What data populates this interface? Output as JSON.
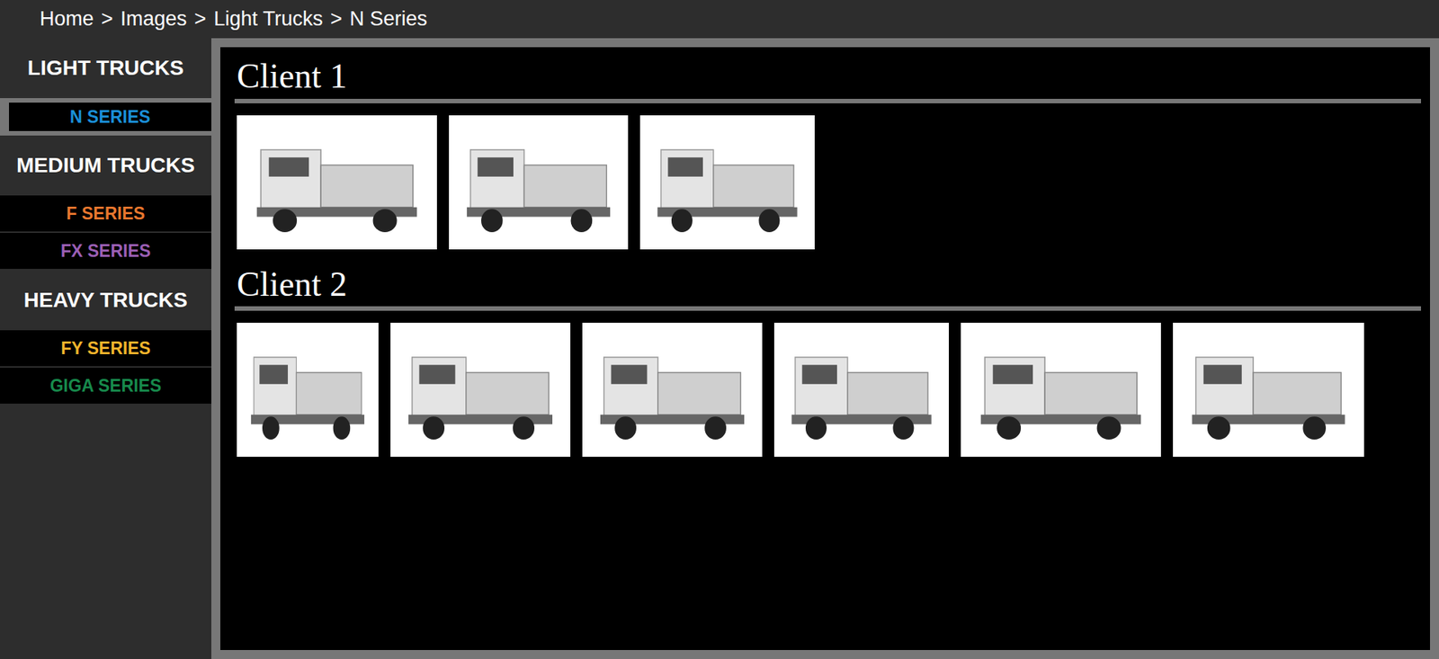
{
  "breadcrumb": {
    "items": [
      "Home",
      "Images",
      "Light Trucks",
      "N Series"
    ],
    "separator": ">"
  },
  "sidebar": {
    "items": [
      {
        "label": "LIGHT TRUCKS",
        "kind": "header"
      },
      {
        "label": "N SERIES",
        "kind": "link",
        "selected": true,
        "color": "#1a8fd8"
      },
      {
        "label": "MEDIUM TRUCKS",
        "kind": "header"
      },
      {
        "label": "F SERIES",
        "kind": "link",
        "selected": false,
        "color": "#e8772e"
      },
      {
        "label": "FX SERIES",
        "kind": "link",
        "selected": false,
        "color": "#9b5fb5"
      },
      {
        "label": "HEAVY TRUCKS",
        "kind": "header"
      },
      {
        "label": "FY SERIES",
        "kind": "link",
        "selected": false,
        "color": "#f2b52c"
      },
      {
        "label": "GIGA SERIES",
        "kind": "link",
        "selected": false,
        "color": "#178a4c"
      }
    ]
  },
  "sections": [
    {
      "title": "Client 1",
      "photos": [
        {
          "kind": "photo"
        },
        {
          "kind": "photo"
        },
        {
          "kind": "photo"
        }
      ]
    },
    {
      "title": "Client 2",
      "photos": [
        {
          "kind": "photo"
        },
        {
          "kind": "photo"
        },
        {
          "kind": "photo"
        },
        {
          "kind": "photo"
        },
        {
          "kind": "photo"
        },
        {
          "kind": "photo"
        }
      ]
    }
  ]
}
